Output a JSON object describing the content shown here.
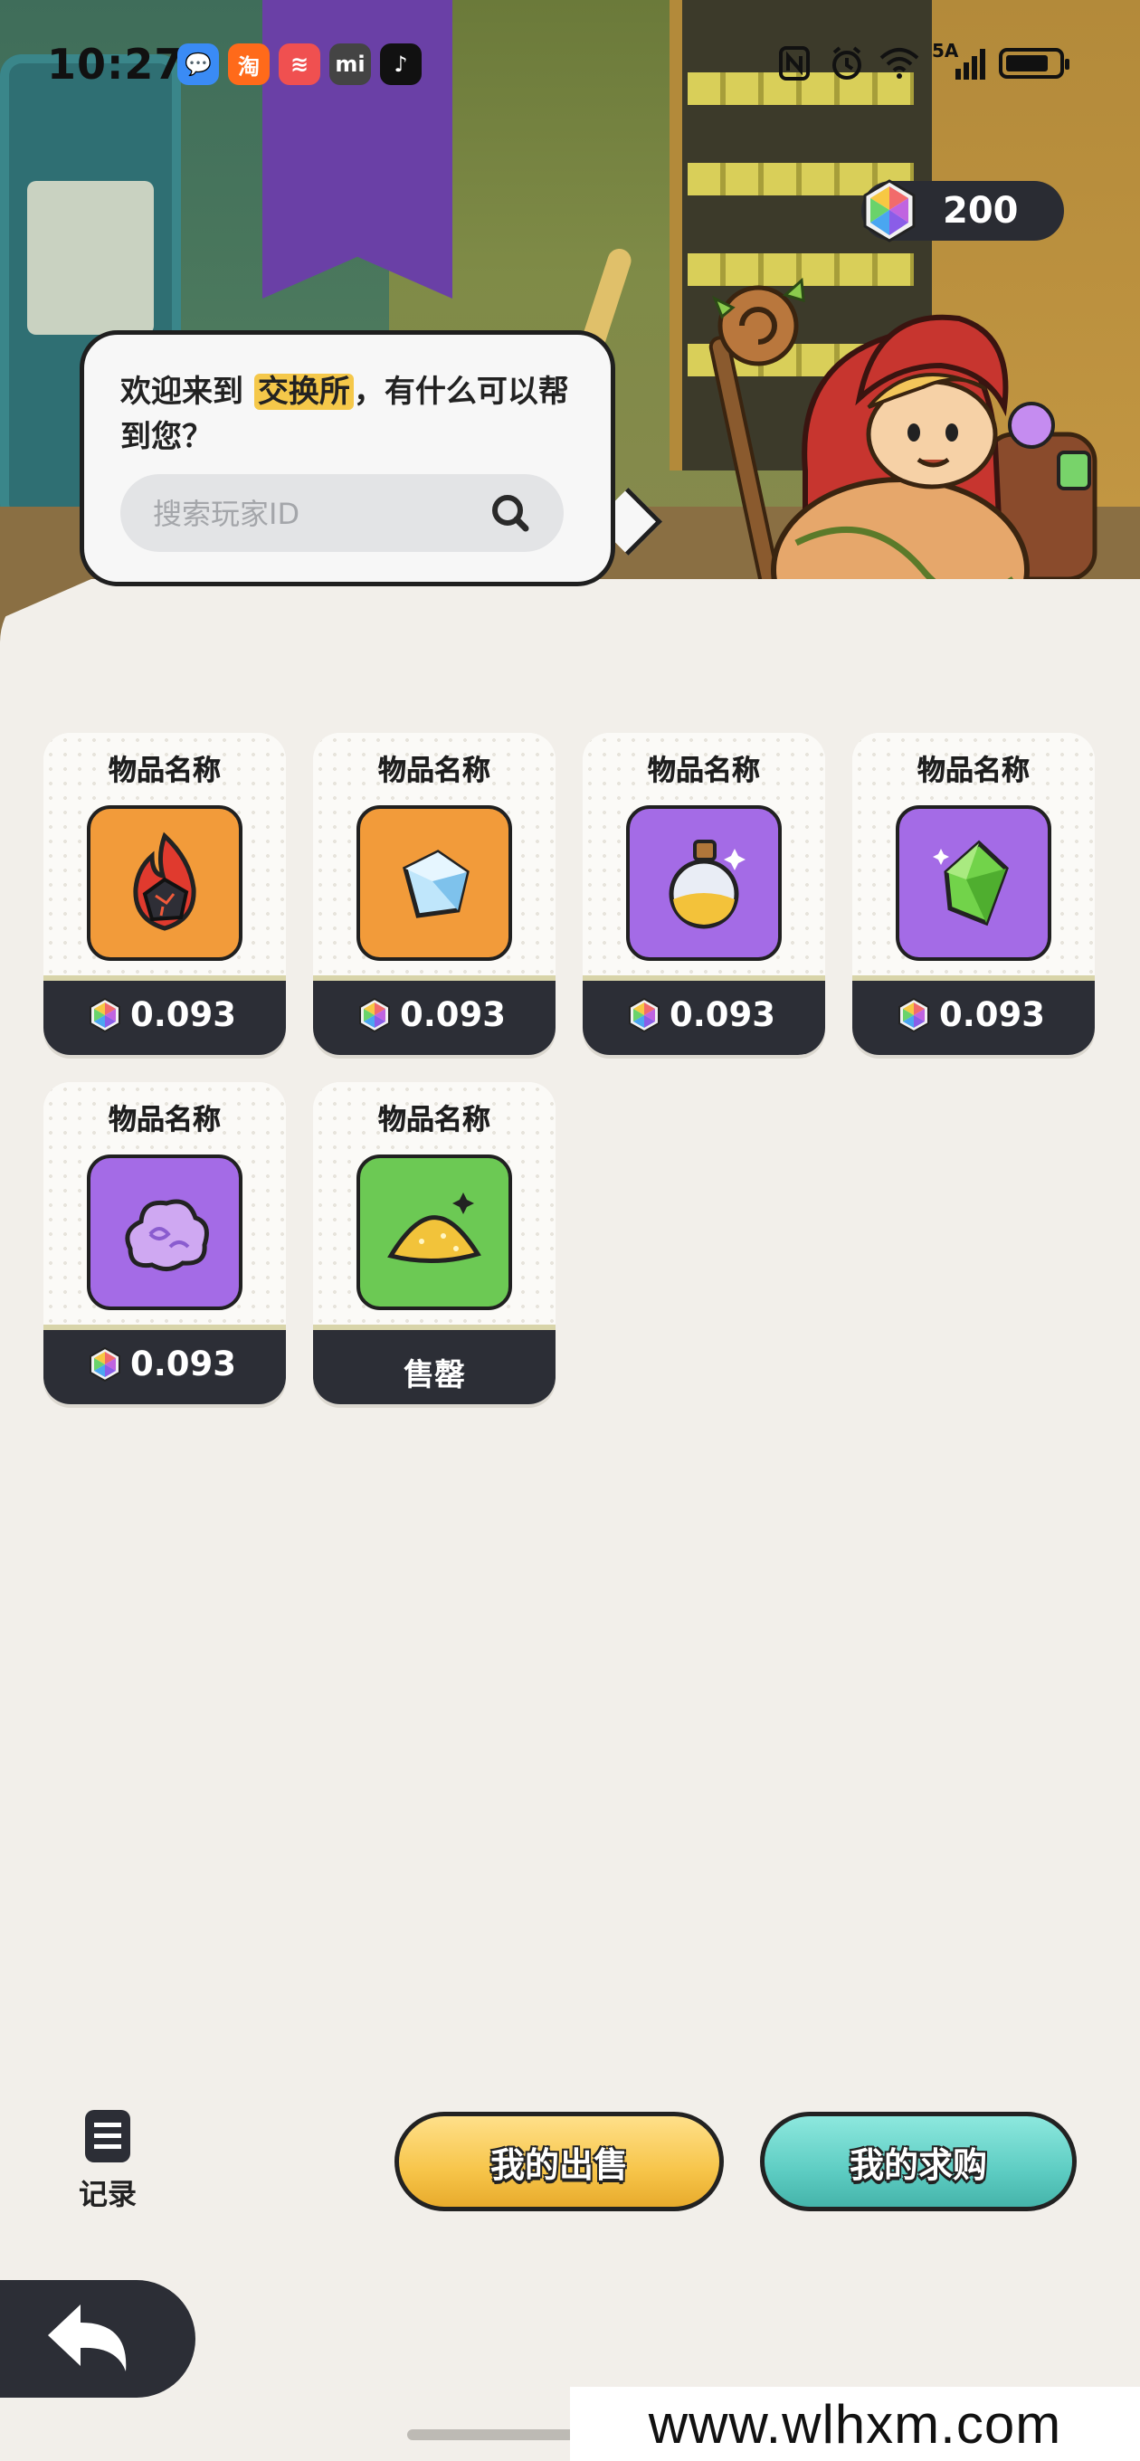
{
  "status_bar": {
    "time": "10:27",
    "notifications": [
      {
        "name": "messages-icon",
        "glyph": "💬",
        "color": "#3a8bf5"
      },
      {
        "name": "taobao-icon",
        "glyph": "淘",
        "color": "#ff6a1a"
      },
      {
        "name": "app-red-icon",
        "glyph": "≋",
        "color": "#f05050"
      },
      {
        "name": "mi-icon",
        "glyph": "mi",
        "color": "#444444"
      },
      {
        "name": "tiktok-icon",
        "glyph": "♪",
        "color": "#111111"
      }
    ],
    "network_label": "5A"
  },
  "currency": {
    "value": "200"
  },
  "bubble": {
    "text_prefix": "欢迎来到 ",
    "text_highlight": "交换所",
    "text_suffix": "，有什么可以帮到您？",
    "search_placeholder": "搜索玩家ID"
  },
  "items": [
    {
      "name": "物品名称",
      "icon": "fire-ore-icon",
      "bg": "#f29b3a",
      "price": "0.093",
      "sold": false
    },
    {
      "name": "物品名称",
      "icon": "ice-crystal-icon",
      "bg": "#f29b3a",
      "price": "0.093",
      "sold": false
    },
    {
      "name": "物品名称",
      "icon": "potion-bottle-icon",
      "bg": "#a46be6",
      "price": "0.093",
      "sold": false
    },
    {
      "name": "物品名称",
      "icon": "green-gem-icon",
      "bg": "#a46be6",
      "price": "0.093",
      "sold": false
    },
    {
      "name": "物品名称",
      "icon": "purple-cloud-icon",
      "bg": "#a46be6",
      "price": "0.093",
      "sold": false
    },
    {
      "name": "物品名称",
      "icon": "gold-dust-icon",
      "bg": "#6cc954",
      "price": "",
      "sold": true,
      "sold_label": "售罄"
    }
  ],
  "bottom": {
    "records_label": "记录",
    "sell_button": "我的出售",
    "buy_button": "我的求购"
  },
  "watermark": "www.wlhxm.com"
}
